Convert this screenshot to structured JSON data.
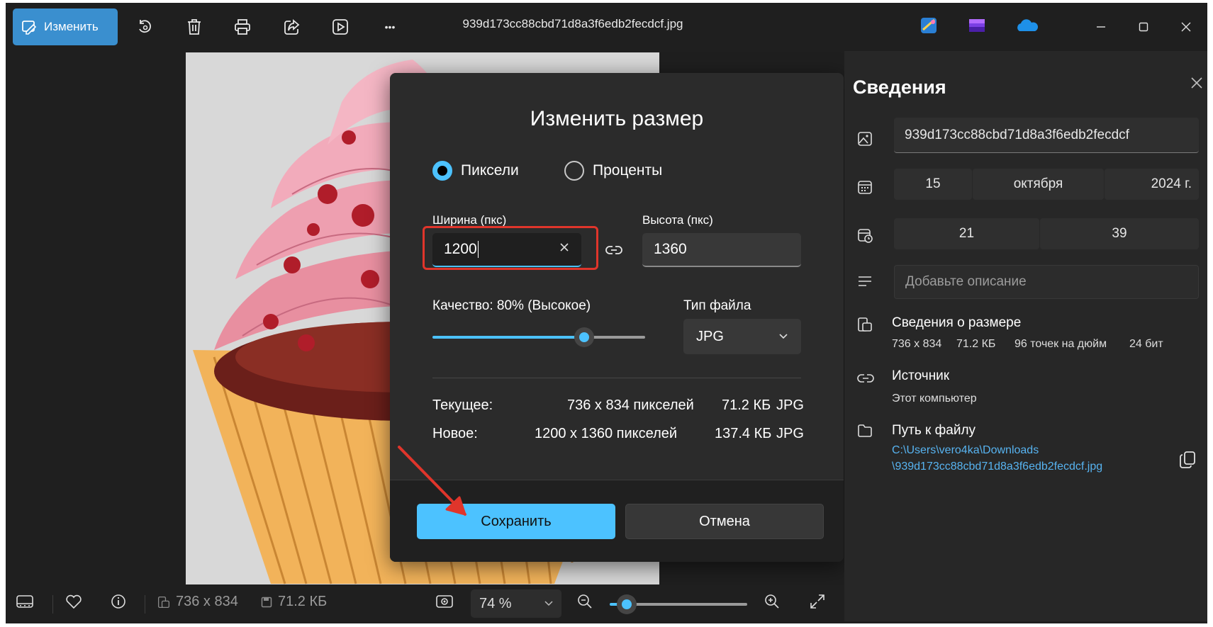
{
  "toolbar": {
    "edit_label": "Изменить",
    "file_title": "939d173cc88cbd71d8a3f6edb2fecdcf.jpg",
    "more_label": "•••"
  },
  "dialog": {
    "title": "Изменить размер",
    "radio_pixels": "Пиксели",
    "radio_percent": "Проценты",
    "width_label": "Ширина (пкс)",
    "height_label": "Высота (пкс)",
    "width_value": "1200",
    "height_value": "1360",
    "quality_label": "Качество: 80% (Высокое)",
    "quality_value": 80,
    "filetype_label": "Тип файла",
    "filetype_value": "JPG",
    "current_label": "Текущее:",
    "current_dims": "736 x 834 пикселей",
    "current_size": "71.2 КБ",
    "current_type": "JPG",
    "new_label": "Новое:",
    "new_dims": "1200 x 1360 пикселей",
    "new_size": "137.4 КБ",
    "new_type": "JPG",
    "save_label": "Сохранить",
    "cancel_label": "Отмена"
  },
  "panel": {
    "title": "Сведения",
    "filename": "939d173cc88cbd71d8a3f6edb2fecdcf",
    "date_day": "15",
    "date_month": "октября",
    "date_year": "2024 г.",
    "time_hour": "21",
    "time_minute": "39",
    "description_placeholder": "Добавьте описание",
    "size_heading": "Сведения о размере",
    "size_dims": "736 x 834",
    "size_kb": "71.2 КБ",
    "size_dpi": "96 точек на дюйм",
    "size_bits": "24 бит",
    "source_heading": "Источник",
    "source_value": "Этот компьютер",
    "path_heading": "Путь к файлу",
    "path_line1": "C:\\Users\\vero4ka\\Downloads",
    "path_line2": "\\939d173cc88cbd71d8a3f6edb2fecdcf.jpg"
  },
  "bottombar": {
    "dims": "736 x 834",
    "size": "71.2 КБ",
    "zoom": "74 %",
    "zoom_value": 74
  },
  "colors": {
    "accent": "#4cc2ff",
    "highlight": "#e0352b",
    "background": "#1f1f1f",
    "panel": "#272727",
    "dialog": "#2b2b2b"
  }
}
